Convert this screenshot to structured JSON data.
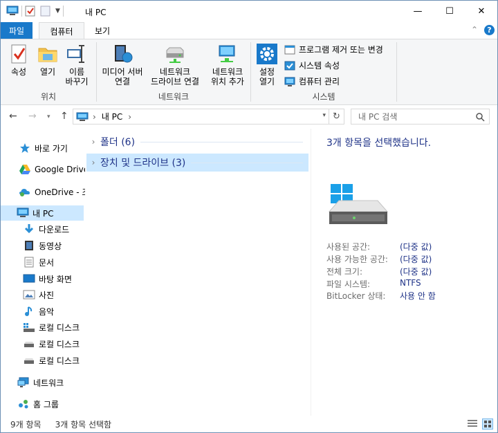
{
  "window": {
    "title": "내 PC",
    "minimize_glyph": "—",
    "maximize_glyph": "☐",
    "close_glyph": "✕"
  },
  "ribbon_tabs": {
    "file": "파일",
    "computer": "컴퓨터",
    "view": "보기",
    "expand_glyph": "⌃",
    "help_glyph": "?"
  },
  "ribbon": {
    "location_group": "위치",
    "properties": "속성",
    "open": "열기",
    "rename_l1": "이름",
    "rename_l2": "바꾸기",
    "network_group": "네트워크",
    "media_l1": "미디어 서버",
    "media_l2": "연결",
    "map_drive_l1": "네트워크",
    "map_drive_l2": "드라이브 연결",
    "add_location_l1": "네트워크",
    "add_location_l2": "위치 추가",
    "system_group": "시스템",
    "settings_l1": "설정",
    "settings_l2": "열기",
    "uninstall": "프로그램 제거 또는 변경",
    "sys_props": "시스템 속성",
    "manage": "컴퓨터 관리"
  },
  "address": {
    "path": "내 PC",
    "sep": "›",
    "search_placeholder": "내 PC 검색"
  },
  "nav": {
    "quick_access": "바로 가기",
    "google_drive": "Google Drive",
    "onedrive": "OneDrive - 조",
    "this_pc": "내 PC",
    "downloads": "다운로드",
    "videos": "동영상",
    "documents": "문서",
    "desktop": "바탕 화면",
    "pictures": "사진",
    "music": "음악",
    "local_disk_1": "로컬 디스크",
    "local_disk_2": "로컬 디스크",
    "local_disk_3": "로컬 디스크",
    "network": "네트워크",
    "homegroup": "홈 그룹"
  },
  "content": {
    "folders": "폴더 (6)",
    "devices": "장치 및 드라이브 (3)"
  },
  "details": {
    "title": "3개 항목을 선택했습니다.",
    "used_label": "사용된 공간:",
    "used_value": "(다중 값)",
    "free_label": "사용 가능한 공간:",
    "free_value": "(다중 값)",
    "total_label": "전체 크기:",
    "total_value": "(다중 값)",
    "fs_label": "파일 시스템:",
    "fs_value": "NTFS",
    "bitlocker_label": "BitLocker 상태:",
    "bitlocker_value": "사용 안 함"
  },
  "status": {
    "count": "9개 항목",
    "selected": "3개 항목 선택함"
  },
  "colors": {
    "accent": "#1979ca",
    "selection": "#cce8ff",
    "link_text": "#1e3287"
  }
}
